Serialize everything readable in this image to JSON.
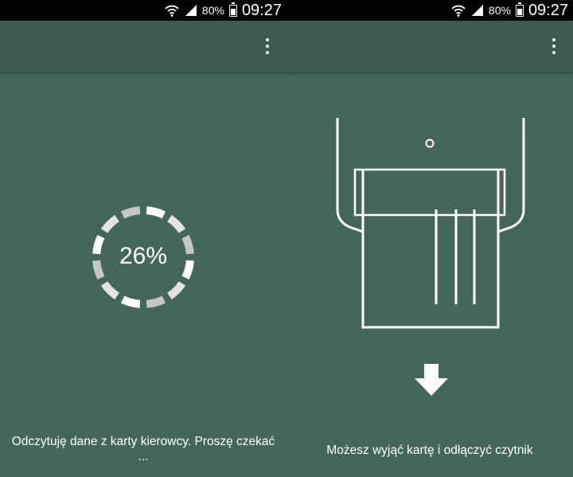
{
  "status_bar": {
    "battery_percent": "80%",
    "time": "09:27",
    "battery_level": 0.8
  },
  "left_screen": {
    "progress_percent": 26,
    "progress_text": "26%",
    "message_line1": "Odczytuję dane z karty kierowcy. Proszę czekać",
    "message_line2": "..."
  },
  "right_screen": {
    "message": "Możesz wyjąć kartę i odłączyć czytnik"
  },
  "icons": {
    "wifi": "wifi-icon",
    "signal": "signal-icon",
    "battery": "battery-icon",
    "overflow": "more-vert-icon",
    "card_reader": "card-reader-icon",
    "arrow": "arrow-down-icon"
  },
  "colors": {
    "background": "#44675a",
    "app_bar": "#3e594f",
    "status_bar": "#000000",
    "foreground": "#ffffff"
  }
}
